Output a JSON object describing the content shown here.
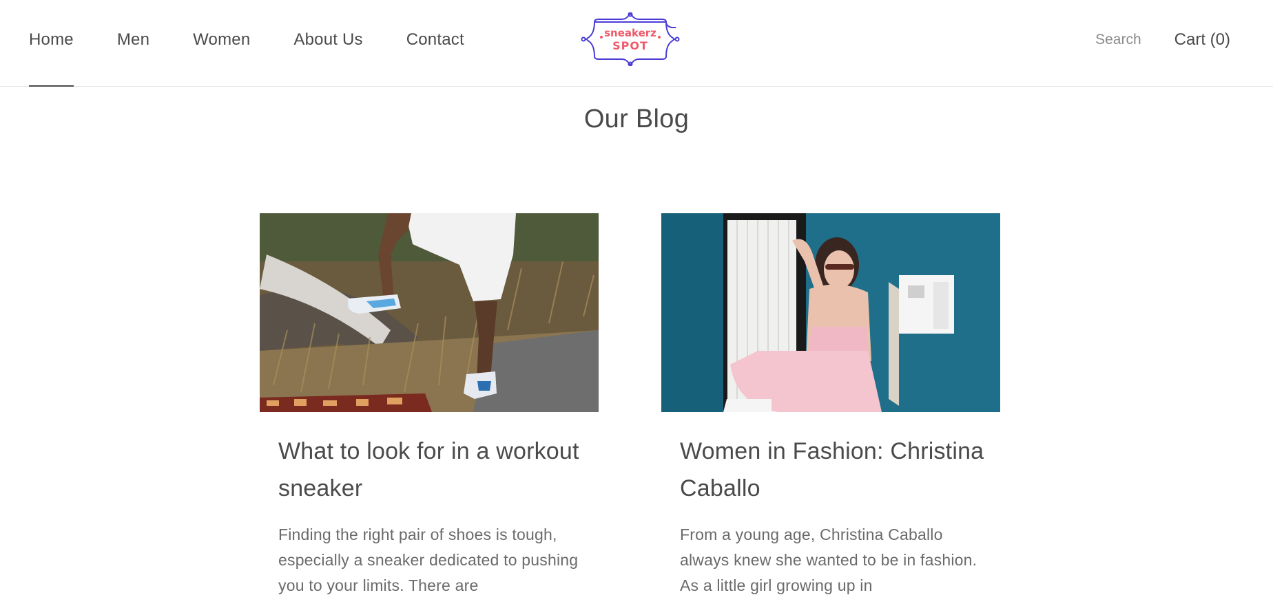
{
  "nav": {
    "items": [
      {
        "label": "Home",
        "active": true
      },
      {
        "label": "Men"
      },
      {
        "label": "Women"
      },
      {
        "label": "About Us"
      },
      {
        "label": "Contact"
      }
    ]
  },
  "logo": {
    "line1": "sneakerz",
    "line2": "SPOT"
  },
  "header": {
    "search_label": "Search",
    "cart_label": "Cart (0)"
  },
  "page": {
    "title": "Our Blog"
  },
  "posts": [
    {
      "title": "What to look for in a workout sneaker",
      "excerpt": "Finding the right pair of shoes is tough, especially a sneaker dedicated to pushing you to your limits.  There are"
    },
    {
      "title": "Women in Fashion: Christina Caballo",
      "excerpt": "From a young age, Christina Caballo always knew she wanted to be in fashion.  As a little girl growing up in"
    }
  ],
  "colors": {
    "logo_frame": "#4a3bd6",
    "logo_text": "#ee5a6a",
    "text": "#4a4a4a"
  }
}
